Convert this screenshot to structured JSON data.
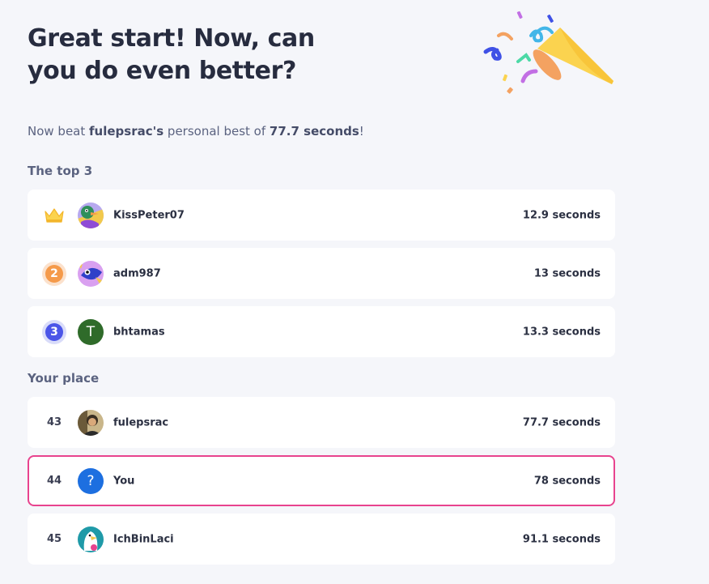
{
  "header": {
    "title_line1": "Great start! Now, can",
    "title_line2": "you do even better?"
  },
  "subtitle": {
    "prefix": "Now beat ",
    "username": "fulepsrac's",
    "middle": " personal best of ",
    "score": "77.7 seconds",
    "suffix": "!"
  },
  "top3": {
    "label": "The top 3",
    "rows": [
      {
        "rank": "",
        "rank_icon": "crown-icon",
        "avatar": "duck-avatar",
        "name": "KissPeter07",
        "time": "12.9 seconds"
      },
      {
        "rank": "2",
        "rank_icon": "silver-medal",
        "avatar": "fish-avatar",
        "name": "adm987",
        "time": "13 seconds"
      },
      {
        "rank": "3",
        "rank_icon": "bronze-medal",
        "avatar_letter": "T",
        "name": "bhtamas",
        "time": "13.3 seconds"
      }
    ]
  },
  "your_place": {
    "label": "Your place",
    "rows": [
      {
        "rank": "43",
        "avatar": "photo-avatar",
        "name": "fulepsrac",
        "time": "77.7 seconds"
      },
      {
        "rank": "44",
        "avatar_glyph": "?",
        "name": "You",
        "time": "78 seconds"
      },
      {
        "rank": "45",
        "avatar": "bird-avatar",
        "name": "IchBinLaci",
        "time": "91.1 seconds"
      }
    ]
  },
  "colors": {
    "highlight_border": "#e8438e",
    "silver": "#f59a4a",
    "bronze": "#4b55e8",
    "you_avatar": "#1d6fe0",
    "t_avatar": "#2f6b2a"
  }
}
